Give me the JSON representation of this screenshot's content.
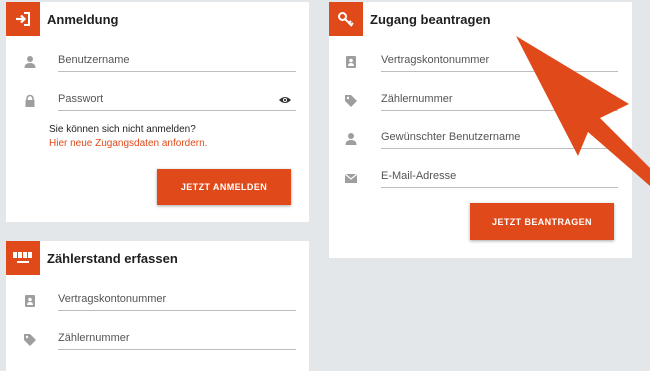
{
  "login": {
    "title": "Anmeldung",
    "username_placeholder": "Benutzername",
    "password_placeholder": "Passwort",
    "help_text": "Sie können sich nicht anmelden?",
    "help_link": "Hier neue Zugangsdaten anfordern.",
    "submit_label": "JETZT ANMELDEN"
  },
  "request": {
    "title": "Zugang beantragen",
    "contract_placeholder": "Vertragskontonummer",
    "meter_placeholder": "Zählernummer",
    "desired_username_placeholder": "Gewünschter Benutzername",
    "email_placeholder": "E-Mail-Adresse",
    "submit_label": "JETZT BEANTRAGEN"
  },
  "meter_reading": {
    "title": "Zählerstand erfassen",
    "contract_placeholder": "Vertragskontonummer",
    "meter_placeholder": "Zählernummer"
  },
  "colors": {
    "accent": "#e04a1a",
    "background": "#e4e7ea",
    "icon": "#9e9e9e"
  },
  "icons": {
    "login_header": "login-arrow-icon",
    "request_header": "key-icon",
    "meter_header": "meter-counter-icon",
    "user": "user-icon",
    "lock": "lock-icon",
    "eye": "eye-icon",
    "contact_card": "contact-card-icon",
    "tag": "tag-icon",
    "mail": "mail-icon",
    "annotation": "arrow-pointer-icon"
  }
}
